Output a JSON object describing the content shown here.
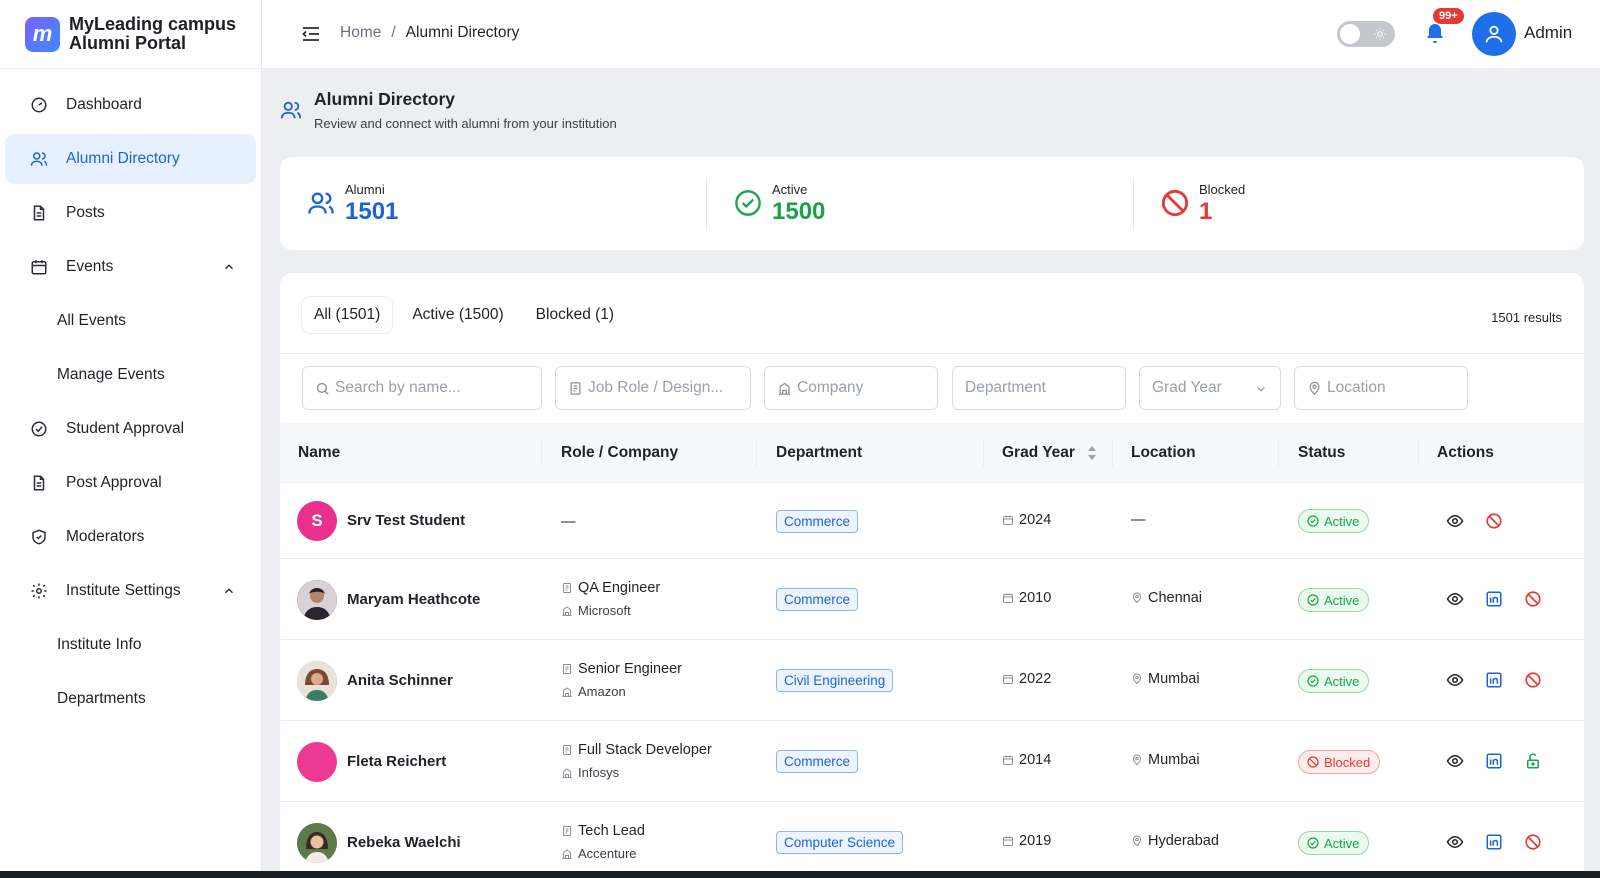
{
  "brand": {
    "line1": "MyLeading campus",
    "line2": "Alumni Portal",
    "logo_letter": "m"
  },
  "sidebar": {
    "items": [
      {
        "label": "Dashboard",
        "icon": "dashboard-gauge-icon"
      },
      {
        "label": "Alumni Directory",
        "icon": "users-icon",
        "active": true
      },
      {
        "label": "Posts",
        "icon": "document-icon"
      },
      {
        "label": "Events",
        "icon": "calendar-icon",
        "expanded": true
      },
      {
        "label": "All Events"
      },
      {
        "label": "Manage Events"
      },
      {
        "label": "Student Approval",
        "icon": "check-circle-icon"
      },
      {
        "label": "Post Approval",
        "icon": "document-icon"
      },
      {
        "label": "Moderators",
        "icon": "shield-check-icon"
      },
      {
        "label": "Institute Settings",
        "icon": "gear-icon",
        "expanded": true
      },
      {
        "label": "Institute Info"
      },
      {
        "label": "Departments"
      }
    ]
  },
  "header": {
    "breadcrumb": {
      "home": "Home",
      "sep": "/",
      "current": "Alumni Directory"
    },
    "notification_count": "99+",
    "user_name": "Admin"
  },
  "page": {
    "title": "Alumni Directory",
    "subtitle": "Review and connect with alumni from your institution"
  },
  "stats": [
    {
      "label": "Alumni",
      "value": "1501",
      "color": "#1d63d8"
    },
    {
      "label": "Active",
      "value": "1500",
      "color": "#1aa34a"
    },
    {
      "label": "Blocked",
      "value": "1",
      "color": "#e53935"
    }
  ],
  "tabs": [
    {
      "label": "All (1501)",
      "selected": true
    },
    {
      "label": "Active (1500)"
    },
    {
      "label": "Blocked (1)"
    }
  ],
  "results_text": "1501 results",
  "filters": {
    "search": "Search by name...",
    "role": "Job Role / Design...",
    "company": "Company",
    "department": "Department",
    "grad_year": "Grad Year",
    "location": "Location"
  },
  "table": {
    "columns": [
      "Name",
      "Role / Company",
      "Department",
      "Grad Year",
      "Location",
      "Status",
      "Actions"
    ],
    "rows": [
      {
        "name": "Srv Test Student",
        "initial": "S",
        "avatar_color": "#e8308c",
        "role": "—",
        "company": "",
        "department": "Commerce",
        "year": "2024",
        "location": "—",
        "status": "Active"
      },
      {
        "name": "Maryam Heathcote",
        "initial": "",
        "avatar_color": "#3a3140",
        "role": "QA Engineer",
        "company": "Microsoft",
        "department": "Commerce",
        "year": "2010",
        "location": "Chennai",
        "status": "Active"
      },
      {
        "name": "Anita Schinner",
        "initial": "",
        "avatar_color": "#c98a6b",
        "role": "Senior Engineer",
        "company": "Amazon",
        "department": "Civil Engineering",
        "year": "2022",
        "location": "Mumbai",
        "status": "Active"
      },
      {
        "name": "Fleta Reichert",
        "initial": "",
        "avatar_color": "#ec3a93",
        "role": "Full Stack Developer",
        "company": "Infosys",
        "department": "Commerce",
        "year": "2014",
        "location": "Mumbai",
        "status": "Blocked"
      },
      {
        "name": "Rebeka Waelchi",
        "initial": "",
        "avatar_color": "#4a6b3a",
        "role": "Tech Lead",
        "company": "Accenture",
        "department": "Computer Science",
        "year": "2019",
        "location": "Hyderabad",
        "status": "Active"
      }
    ]
  }
}
